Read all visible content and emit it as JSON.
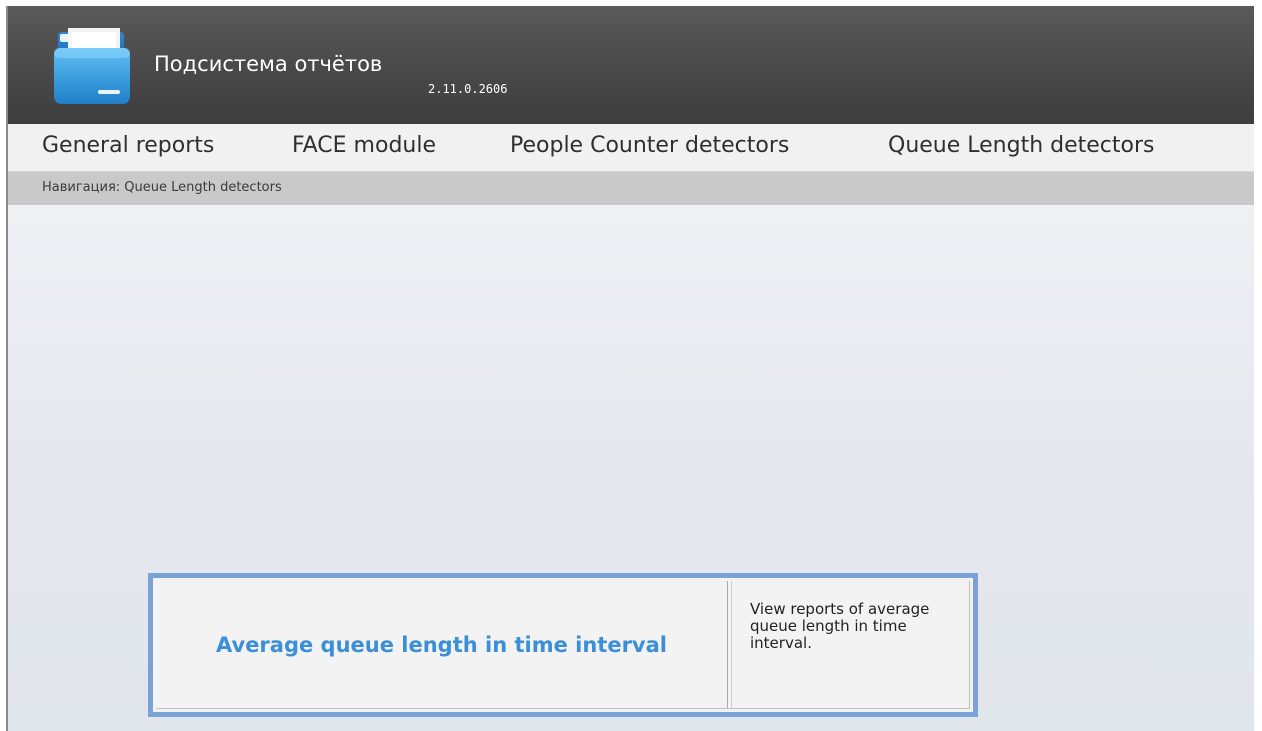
{
  "header": {
    "title": "Подсистема отчётов",
    "version": "2.11.0.2606",
    "logo_icon": "folder-icon"
  },
  "menu": {
    "items": [
      {
        "label": "General reports"
      },
      {
        "label": "FACE module"
      },
      {
        "label": "People Counter detectors"
      },
      {
        "label": "Queue Length detectors"
      }
    ]
  },
  "breadcrumb": {
    "text": "Навигация: Queue Length detectors"
  },
  "reports": [
    {
      "name": "Average queue length in time interval",
      "description": "View reports of average queue length in time interval."
    }
  ],
  "colors": {
    "header_dark": "#4a4a4a",
    "accent_link": "#3a8fd8",
    "card_border": "#7aa2d6"
  }
}
